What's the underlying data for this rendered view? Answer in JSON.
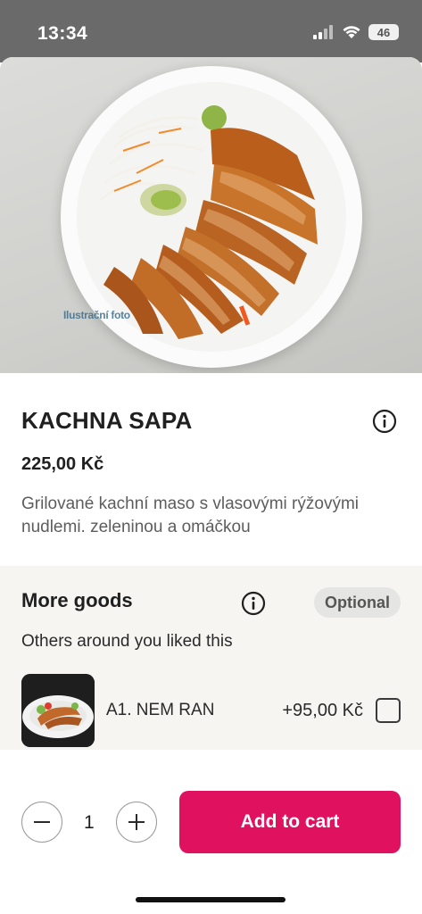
{
  "status_bar": {
    "time": "13:34",
    "battery": "46",
    "icons": [
      "signal-icon",
      "wifi-icon",
      "battery-icon"
    ]
  },
  "product": {
    "watermark": "Ilustrační foto",
    "title": "KACHNA SAPA",
    "price": "225,00 Kč",
    "description": "Grilované kachní maso s vlasovými rýžovými nudlemi. zeleninou a omáčkou"
  },
  "more_goods": {
    "title": "More goods",
    "badge": "Optional",
    "subtitle": "Others around you liked this",
    "items": [
      {
        "name": "A1. NEM RAN",
        "price": "+95,00 Kč",
        "checked": false
      }
    ]
  },
  "cart": {
    "quantity": "1",
    "add_label": "Add to cart"
  },
  "colors": {
    "accent": "#e0125f",
    "section_bg": "#f6f5f2"
  }
}
